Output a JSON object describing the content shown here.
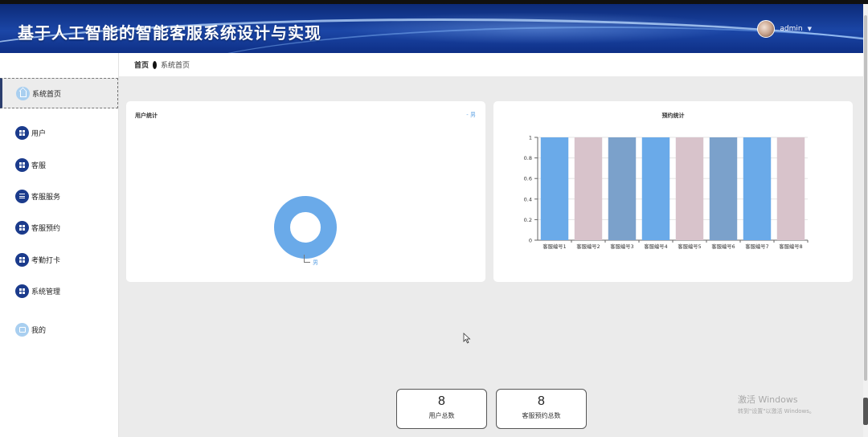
{
  "app": {
    "title": "基于人工智能的智能客服系统设计与实现",
    "user": "admin"
  },
  "breadcrumb": {
    "home": "首页",
    "current": "系统首页"
  },
  "sidebar": {
    "items": [
      {
        "label": "系统首页",
        "icon": "home-icon",
        "active": true
      },
      {
        "label": "用户",
        "icon": "grid-icon"
      },
      {
        "label": "客服",
        "icon": "grid-icon"
      },
      {
        "label": "客服服务",
        "icon": "list-icon"
      },
      {
        "label": "客服预约",
        "icon": "grid-icon"
      },
      {
        "label": "考勤打卡",
        "icon": "grid-icon"
      },
      {
        "label": "系统管理",
        "icon": "grid-icon"
      },
      {
        "label": "我的",
        "icon": "card-icon"
      }
    ]
  },
  "user_panel": {
    "title": "用户统计",
    "legend": "男",
    "slice_label": "男"
  },
  "booking_panel": {
    "title": "预约统计"
  },
  "stats": [
    {
      "value": "8",
      "label": "用户总数"
    },
    {
      "value": "8",
      "label": "客服预约总数"
    }
  ],
  "watermark": {
    "line1": "激活 Windows",
    "line2": "转到\"设置\"以激活 Windows。"
  },
  "colors": {
    "header": "#1b46a6",
    "accent": "#1b3b8c",
    "bar_blue": "#6aaae9",
    "bar_pink": "#d8c3cb",
    "bar_steel": "#7ba1cb"
  },
  "chart_data": [
    {
      "type": "pie",
      "title": "用户统计",
      "categories": [
        "男"
      ],
      "values": [
        1
      ]
    },
    {
      "type": "bar",
      "title": "预约统计",
      "categories": [
        "客服编号1",
        "客服编号2",
        "客服编号3",
        "客服编号4",
        "客服编号5",
        "客服编号6",
        "客服编号7",
        "客服编号8"
      ],
      "values": [
        1,
        1,
        1,
        1,
        1,
        1,
        1,
        1
      ],
      "yticks": [
        "0",
        "0.2",
        "0.4",
        "0.6",
        "0.8",
        "1"
      ],
      "ylim": [
        0,
        1
      ],
      "bar_colors": [
        "#6aaae9",
        "#d8c3cb",
        "#7ba1cb",
        "#6aaae9",
        "#d8c3cb",
        "#7ba1cb",
        "#6aaae9",
        "#d8c3cb"
      ],
      "grid": true
    }
  ]
}
